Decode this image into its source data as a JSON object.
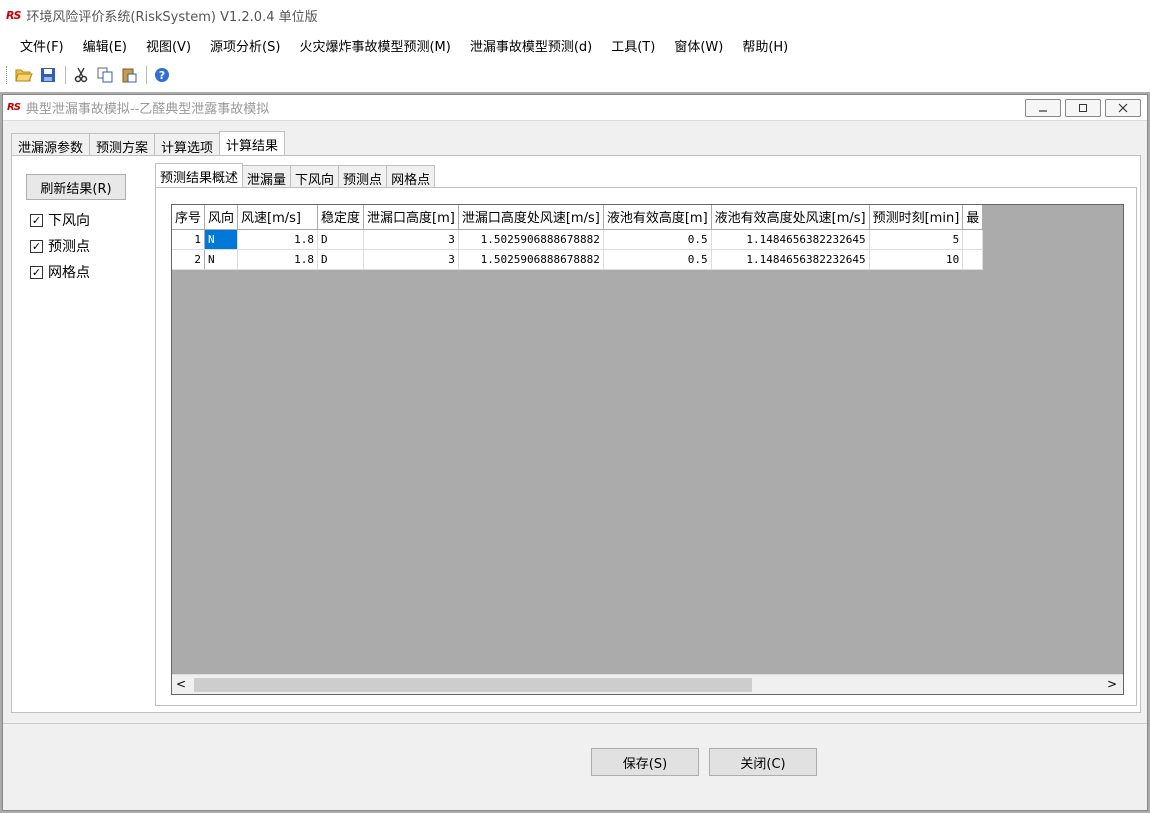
{
  "app": {
    "logo": "RS",
    "title": "环境风险评价系统(RiskSystem) V1.2.0.4 单位版"
  },
  "menu": [
    "文件(F)",
    "编辑(E)",
    "视图(V)",
    "源项分析(S)",
    "火灾爆炸事故模型预测(M)",
    "泄漏事故模型预测(d)",
    "工具(T)",
    "窗体(W)",
    "帮助(H)"
  ],
  "child": {
    "logo": "RS",
    "title": "典型泄漏事故模拟--乙醛典型泄露事故模拟"
  },
  "tabs": [
    "泄漏源参数",
    "预测方案",
    "计算选项",
    "计算结果"
  ],
  "subtabs": [
    "预测结果概述",
    "泄漏量",
    "下风向",
    "预测点",
    "网格点"
  ],
  "refresh_label": "刷新结果(R)",
  "checks": [
    {
      "label": "下风向",
      "checked": true
    },
    {
      "label": "预测点",
      "checked": true
    },
    {
      "label": "网格点",
      "checked": true
    }
  ],
  "grid": {
    "columns": [
      "序号",
      "风向",
      "风速[m/s]",
      "稳定度",
      "泄漏口高度[m]",
      "泄漏口高度处风速[m/s]",
      "液池有效高度[m]",
      "液池有效高度处风速[m/s]",
      "预测时刻[min]",
      "最"
    ],
    "rows": [
      [
        "1",
        "N",
        "1.8",
        "D",
        "3",
        "1.5025906888678882",
        "0.5",
        "1.1484656382232645",
        "5",
        ""
      ],
      [
        "2",
        "N",
        "1.8",
        "D",
        "3",
        "1.5025906888678882",
        "0.5",
        "1.1484656382232645",
        "10",
        ""
      ]
    ]
  },
  "scroll": {
    "left": "<",
    "right": ">"
  },
  "footer": {
    "save_label": "保存(S)",
    "close_label": "关闭(C)"
  }
}
